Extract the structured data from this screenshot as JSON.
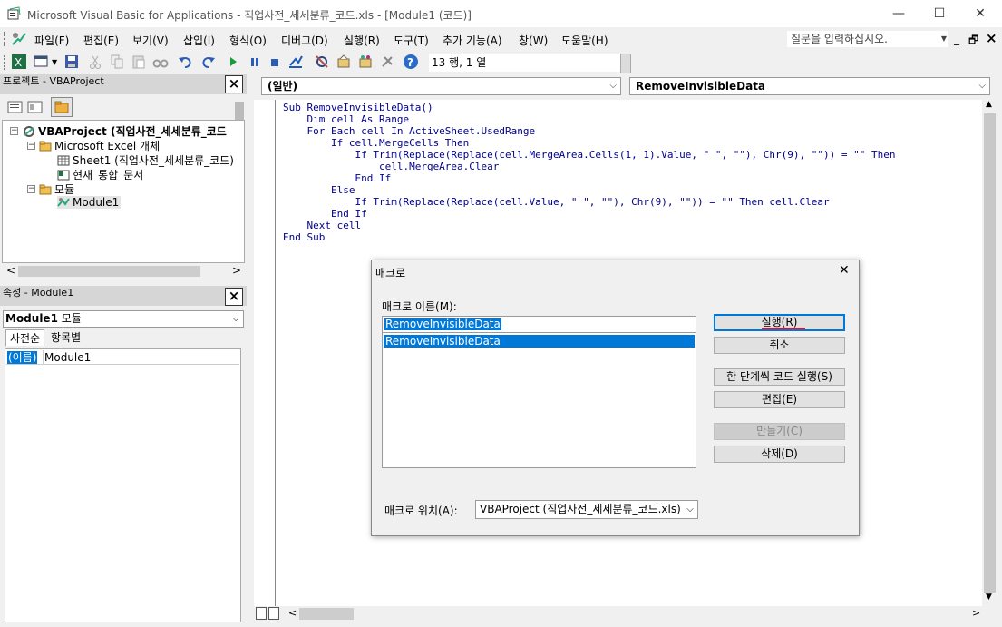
{
  "window": {
    "title": "Microsoft Visual Basic for Applications - 직업사전_세세분류_코드.xls - [Module1 (코드)]",
    "minimize_glyph": "—",
    "maximize_glyph": "☐",
    "close_glyph": "✕"
  },
  "menubar": {
    "items": [
      "파일(F)",
      "편집(E)",
      "보기(V)",
      "삽입(I)",
      "형식(O)",
      "디버그(D)",
      "실행(R)",
      "도구(T)",
      "추가 기능(A)",
      "창(W)",
      "도움말(H)"
    ],
    "ask_placeholder": "질문을 입력하십시오.",
    "child_minimize": "_",
    "child_restore": "🗗",
    "child_close": "×"
  },
  "toolbar": {
    "cursor_position": "13 행, 1 열"
  },
  "project_panel": {
    "title": "프로젝트 - VBAProject",
    "close": "×",
    "tree": {
      "project": "VBAProject (직업사전_세세분류_코드",
      "excel_objects": "Microsoft Excel 개체",
      "sheet1": "Sheet1 (직업사전_세세분류_코드)",
      "workbook": "현재_통합_문서",
      "modules_folder": "모듈",
      "module1": "Module1"
    },
    "scroll_left": "<",
    "scroll_right": ">"
  },
  "properties_panel": {
    "title": "속성 - Module1",
    "close": "×",
    "object_combo_bold": "Module1",
    "object_combo_rest": " 모듈",
    "tabs": [
      "사전순",
      "항목별"
    ],
    "rows": [
      {
        "name": "(이름)",
        "value": "Module1"
      }
    ]
  },
  "code_window": {
    "object_combo": "(일반)",
    "procedure_combo": "RemoveInvisibleData",
    "lines": [
      "Sub RemoveInvisibleData()",
      "    Dim cell As Range",
      "    For Each cell In ActiveSheet.UsedRange",
      "        If cell.MergeCells Then",
      "            If Trim(Replace(Replace(cell.MergeArea.Cells(1, 1).Value, \" \", \"\"), Chr(9), \"\")) = \"\" Then",
      "                cell.MergeArea.Clear",
      "            End If",
      "        Else",
      "            If Trim(Replace(Replace(cell.Value, \" \", \"\"), Chr(9), \"\")) = \"\" Then cell.Clear",
      "        End If",
      "    Next cell",
      "End Sub"
    ]
  },
  "macro_dialog": {
    "title": "매크로",
    "close": "✕",
    "name_label": "매크로 이름(M):",
    "name_value": "RemoveInvisibleData",
    "list_items": [
      "RemoveInvisibleData"
    ],
    "buttons": {
      "run": "실행(R)",
      "cancel": "취소",
      "step_into": "한 단계씩 코드 실행(S)",
      "edit": "편집(E)",
      "create": "만들기(C)",
      "delete": "삭제(D)"
    },
    "location_label": "매크로 위치(A):",
    "location_value": "VBAProject (직업사전_세세분류_코드.xls)"
  },
  "colors": {
    "selection": "#0078d7",
    "code_text": "#00008b",
    "highlight_underline": "#e81123"
  }
}
